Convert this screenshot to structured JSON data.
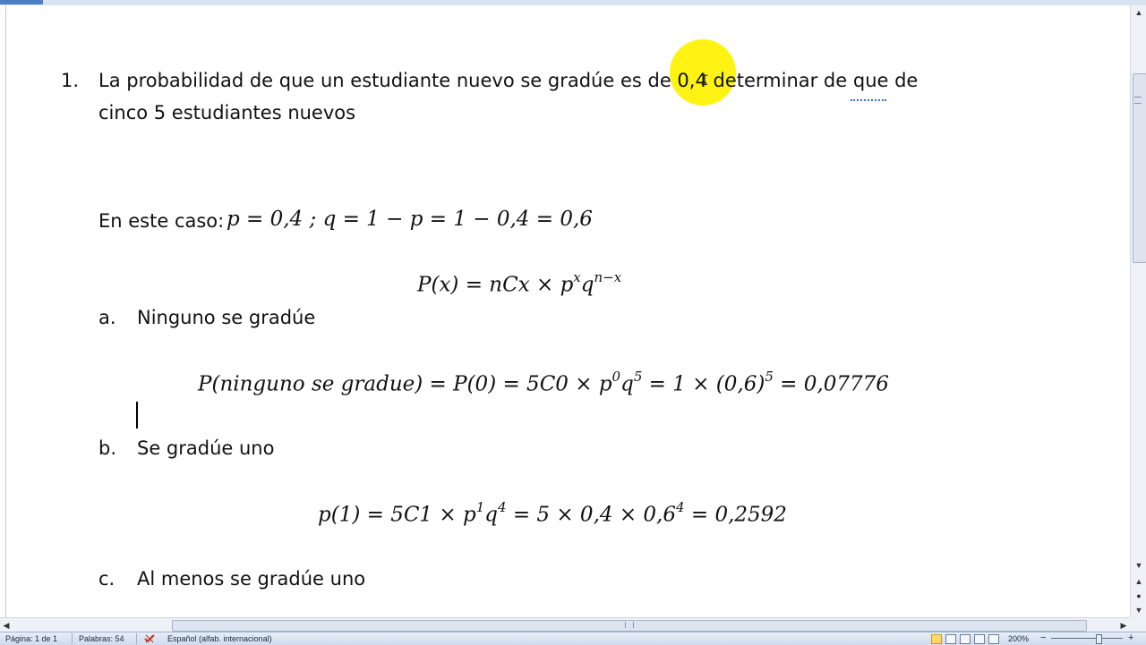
{
  "document": {
    "item_number": "1.",
    "problem_line1": "La probabilidad de que un estudiante nuevo se gradúe es de 0,4 determinar de que de",
    "problem_line2": "cinco 5 estudiantes nuevos",
    "case_label": "En este caso:",
    "case_formula": "p = 0,4  ;  q = 1 − p = 1 − 0,4 = 0,6",
    "general_formula": {
      "base": "P(x) = nCx  × p",
      "sup1": "x",
      "mid": "q",
      "sup2": "n−x"
    },
    "parts": [
      {
        "letter": "a.",
        "label": "Ninguno se gradúe",
        "formula": {
          "t1": "P(ninguno se gradue) = P(0) = 5C0 × p",
          "s1": "0",
          "t2": "q",
          "s2": "5",
          "t3": " = 1 × (0,6)",
          "s3": "5",
          "t4": " = 0,07776"
        }
      },
      {
        "letter": "b.",
        "label": "Se gradúe uno",
        "formula": {
          "t1": "p(1) = 5C1 × p",
          "s1": "1",
          "t2": "q",
          "s2": "4",
          "t3": " = 5 × 0,4 × 0,6",
          "s3": "4",
          "t4": " = 0,2592"
        }
      },
      {
        "letter": "c.",
        "label": "Al menos se gradúe uno"
      }
    ]
  },
  "statusbar": {
    "page": "Página: 1 de 1",
    "words": "Palabras: 54",
    "language": "Español (alfab. internacional)",
    "zoom": "200%",
    "zoom_minus": "−",
    "zoom_plus": "+"
  },
  "icons": {
    "spellcheck": "spellcheck-icon",
    "scroll_up": "▲",
    "scroll_down": "▼",
    "scroll_left": "◀",
    "scroll_right": "▶",
    "prev_page": "▲",
    "next_page": "▼",
    "select_browse": "●",
    "ruler": "⚙"
  }
}
